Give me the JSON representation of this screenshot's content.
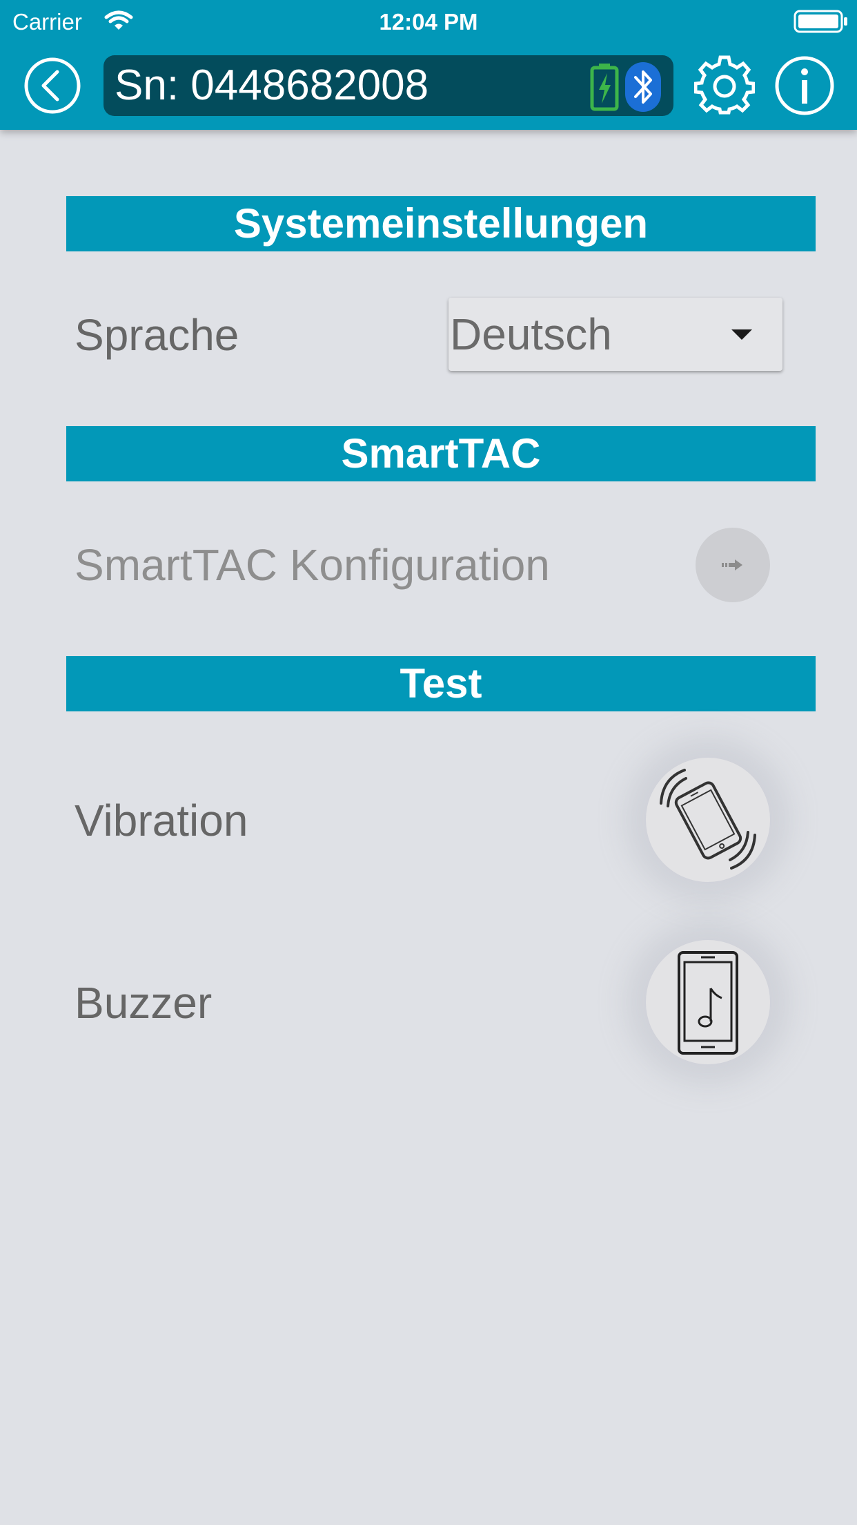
{
  "status_bar": {
    "carrier": "Carrier",
    "time": "12:04 PM"
  },
  "header": {
    "serial_label": "Sn: 0448682008",
    "icons": [
      "back-icon",
      "battery-charging-icon",
      "bluetooth-icon",
      "gear-icon",
      "info-icon"
    ]
  },
  "sections": {
    "system": {
      "title": "Systemeinstellungen",
      "language_label": "Sprache",
      "language_value": "Deutsch"
    },
    "smarttac": {
      "title": "SmartTAC",
      "config_label": "SmartTAC Konfiguration"
    },
    "test": {
      "title": "Test",
      "vibration_label": "Vibration",
      "buzzer_label": "Buzzer"
    }
  },
  "colors": {
    "accent": "#0298b8",
    "serial_box": "#034c5c",
    "background": "#dfe1e6",
    "battery_green": "#3db54a",
    "bluetooth_blue": "#1b6fd6"
  }
}
